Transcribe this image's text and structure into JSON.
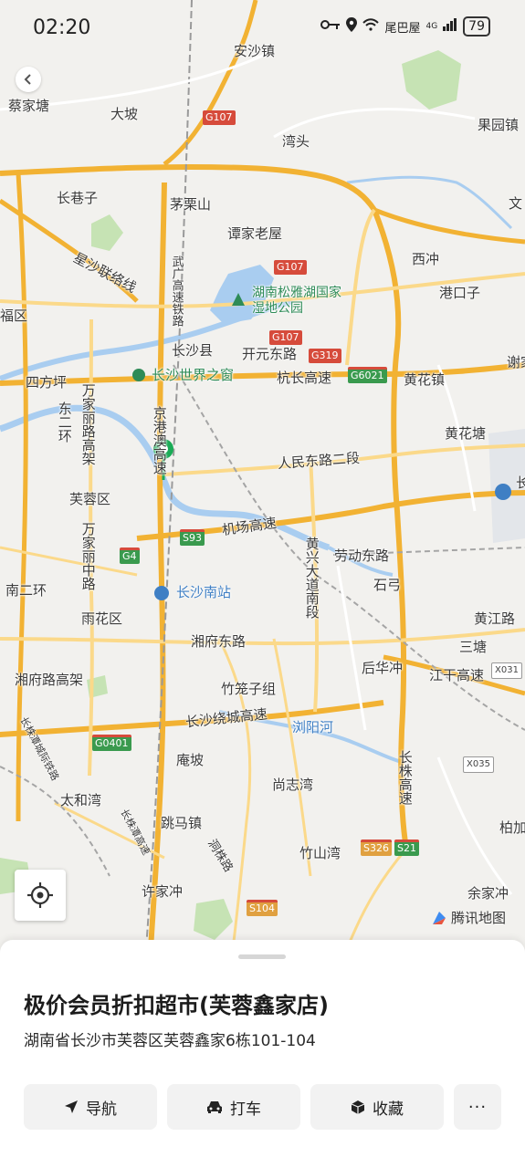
{
  "status_bar": {
    "time": "02:20",
    "carrier": "尾巴屋",
    "battery": "79",
    "network": "4G"
  },
  "map": {
    "places": {
      "caijiatang": "蔡家塘",
      "anshazhen": "安沙镇",
      "dapo": "大坡",
      "guoyuanzhen": "果园镇",
      "wantou": "湾头",
      "changxiangzi": "长巷子",
      "maolishan": "茅栗山",
      "wen": "文",
      "tanjialaowu": "谭家老屋",
      "xichong": "西冲",
      "gangkouzi": "港口子",
      "xingsha_line": "星沙联络线",
      "wuguang": "武广高速铁路",
      "park": "湖南松雅湖国家湿地公园",
      "fuqu": "福区",
      "changshaxian": "长沙县",
      "kaiyuan": "开元东路",
      "xie": "谢家",
      "sifangping": "四方坪",
      "window": "长沙世界之窗",
      "hangchang": "杭长高速",
      "huanghua": "黄花镇",
      "dongerhuan": "东二环",
      "wanjiali_n": "万家丽路高架",
      "jinggang": "京港澳高速",
      "huanghuatang": "黄花塘",
      "renmin": "人民东路二段",
      "furong": "芙蓉区",
      "chang_airport": "长",
      "wanjiali_m": "万家丽中路",
      "jichang": "机场高速",
      "huangxing": "黄兴大道南段",
      "laodong": "劳动东路",
      "shigong": "石弓",
      "nanerhuan": "南二环",
      "south_station": "长沙南站",
      "yuhua": "雨花区",
      "huangjiang": "黄江路",
      "sanbai": "三塘",
      "xiangfu": "湘府东路",
      "houhuachong": "后华冲",
      "xiangfu_gj": "湘府路高架",
      "jianggan": "江干高速",
      "zhulongzi": "竹笼子组",
      "raocheng": "长沙绕城高速",
      "liuyang": "浏阳河",
      "yanpo": "庵坡",
      "shangzhiwan": "尚志湾",
      "changzhu": "长株高速",
      "taihechong": "太和湾",
      "tiaoma": "跳马镇",
      "zhushanwan": "竹山湾",
      "baijia": "柏加",
      "xujiachong": "许家冲",
      "dongzhu": "洞株路",
      "yujiachong": "余家冲",
      "left_rail": "长株潭城际铁路",
      "left_road2": "长株潭高速"
    },
    "shields": {
      "g107a": "G107",
      "g107b": "G107",
      "g107c": "G107",
      "g319": "G319",
      "g6021": "G6021",
      "g4": "G4",
      "s93": "S93",
      "g0401": "G0401",
      "x031": "X031",
      "x035": "X035",
      "s326": "S326",
      "s21": "S21",
      "s104": "S104"
    },
    "logo": "腾讯地图",
    "colors": {
      "highway": "#f2b233",
      "road": "#fbd98a",
      "water": "#a9cdf0",
      "green": "#c6e3b4",
      "pin": "#1aab56"
    }
  },
  "poi": {
    "title": "极价会员折扣超市(芙蓉鑫家店)",
    "address": "湖南省长沙市芙蓉区芙蓉鑫家6栋101-104"
  },
  "actions": {
    "navigate": "导航",
    "taxi": "打车",
    "favorite": "收藏",
    "more": "···"
  }
}
